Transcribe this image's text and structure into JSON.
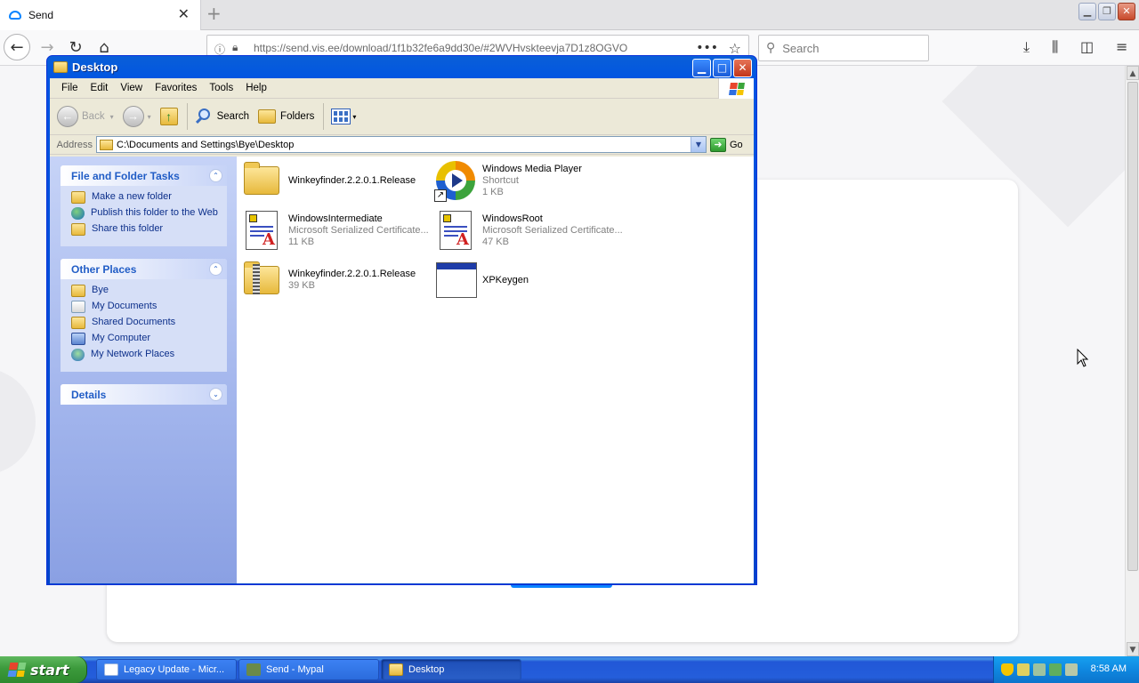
{
  "firefox": {
    "tab_title": "Send",
    "new_tab_glyph": "+",
    "url": "https://send.vis.ee/download/1f1b32fe6a9dd30e/#2WVHvskteevja7D1z8OGVO",
    "search_placeholder": "Search",
    "icons": [
      "send-cloud-icon",
      "tab-close-icon",
      "back-icon",
      "forward-icon",
      "reload-icon",
      "home-icon",
      "info-icon",
      "lock-icon",
      "page-actions-icon",
      "bookmark-star-icon",
      "search-icon",
      "download-icon",
      "library-icon",
      "sidebar-icon",
      "menu-icon"
    ],
    "accent": "#0a84ff"
  },
  "explorer": {
    "title": "Desktop",
    "menu": [
      "File",
      "Edit",
      "View",
      "Favorites",
      "Tools",
      "Help"
    ],
    "toolbar": {
      "back": "Back",
      "search": "Search",
      "folders": "Folders"
    },
    "address": {
      "label": "Address",
      "value": "C:\\Documents and Settings\\Bye\\Desktop",
      "go": "Go"
    },
    "tasks_panel": {
      "title": "File and Folder Tasks",
      "items": [
        "Make a new folder",
        "Publish this folder to the Web",
        "Share this folder"
      ]
    },
    "places_panel": {
      "title": "Other Places",
      "items": [
        "Bye",
        "My Documents",
        "Shared Documents",
        "My Computer",
        "My Network Places"
      ]
    },
    "details_panel": {
      "title": "Details"
    },
    "files": [
      {
        "name": "Winkeyfinder.2.2.0.1.Release",
        "line2": "",
        "line3": "",
        "icon": "folder-icon"
      },
      {
        "name": "Windows Media Player",
        "line2": "Shortcut",
        "line3": "1 KB",
        "icon": "media-player-icon"
      },
      {
        "name": "WindowsIntermediate",
        "line2": "Microsoft Serialized Certificate...",
        "line3": "11 KB",
        "icon": "certificate-icon"
      },
      {
        "name": "WindowsRoot",
        "line2": "Microsoft Serialized Certificate...",
        "line3": "47 KB",
        "icon": "certificate-icon"
      },
      {
        "name": "Winkeyfinder.2.2.0.1.Release",
        "line2": "39 KB",
        "line3": "",
        "icon": "zip-folder-icon"
      },
      {
        "name": "XPKeygen",
        "line2": "",
        "line3": "",
        "icon": "application-icon"
      }
    ],
    "colors": {
      "titlebar": "#0054e3",
      "taskpane_link": "#0c2f8a",
      "taskpane_heading": "#215dc6"
    }
  },
  "taskbar": {
    "start_label": "start",
    "tasks": [
      {
        "label": "Legacy Update - Micr...",
        "active": false
      },
      {
        "label": "Send - Mypal",
        "active": false
      },
      {
        "label": "Desktop",
        "active": true
      }
    ],
    "clock": "8:58 AM"
  }
}
